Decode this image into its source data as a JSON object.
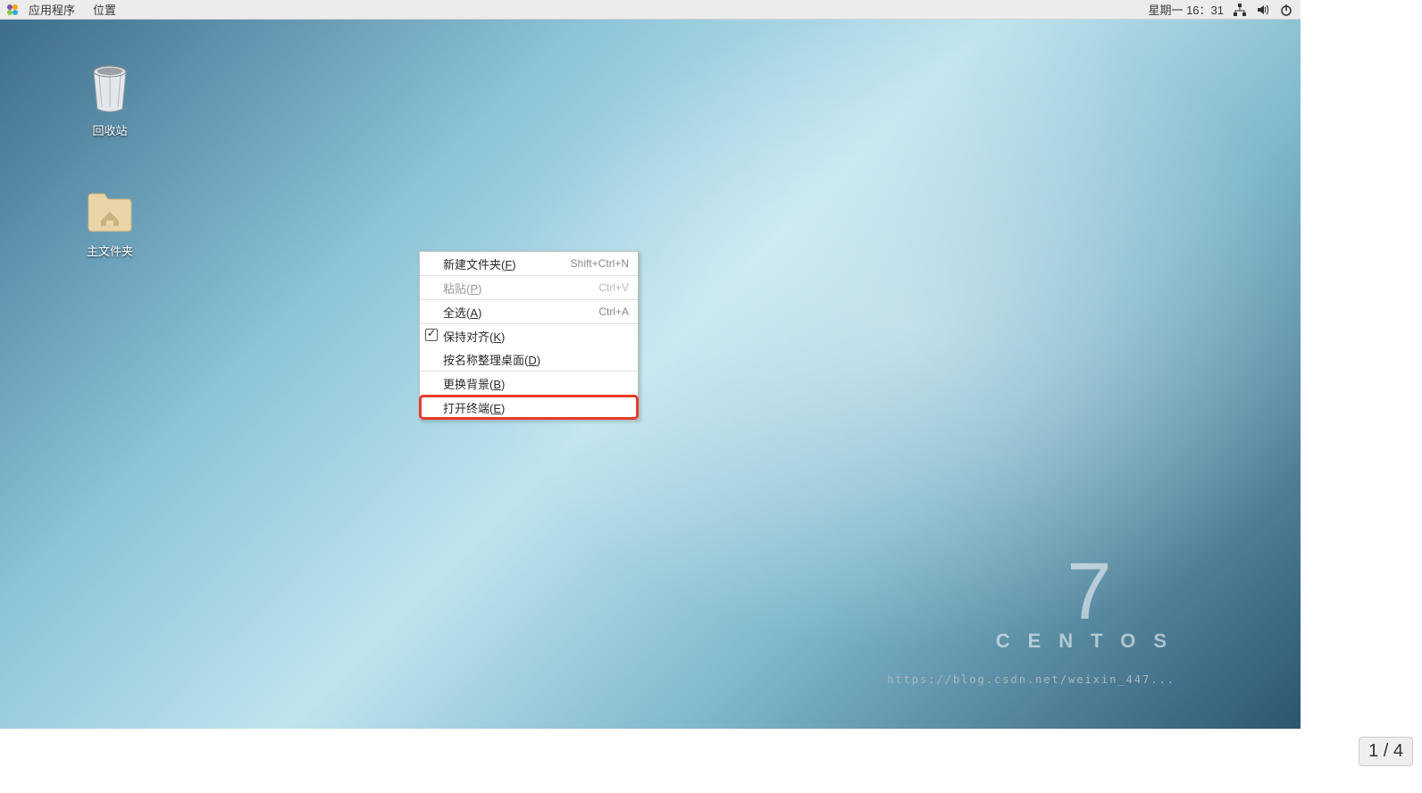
{
  "panel": {
    "menus": {
      "apps": "应用程序",
      "places": "位置"
    },
    "datetime": "星期一 16：31"
  },
  "desktop": {
    "trash": "回收站",
    "home": "主文件夹"
  },
  "context_menu": {
    "new_folder": {
      "label": "新建文件夹(",
      "accel": "F",
      "suffix": ")",
      "shortcut": "Shift+Ctrl+N"
    },
    "paste": {
      "label": "粘贴(",
      "accel": "P",
      "suffix": ")",
      "shortcut": "Ctrl+V"
    },
    "select_all": {
      "label": "全选(",
      "accel": "A",
      "suffix": ")",
      "shortcut": "Ctrl+A"
    },
    "keep_aligned": {
      "label": "保持对齐(",
      "accel": "K",
      "suffix": ")"
    },
    "sort_by_name": {
      "label": "按名称整理桌面(",
      "accel": "D",
      "suffix": ")"
    },
    "change_bg": {
      "label": "更换背景(",
      "accel": "B",
      "suffix": ")"
    },
    "open_terminal": {
      "label": "打开终端(",
      "accel": "E",
      "suffix": ")"
    }
  },
  "brand": {
    "version": "7",
    "name": "CENTOS"
  },
  "page": {
    "current": "1",
    "sep": " / ",
    "total": "4"
  },
  "watermark": "https://blog.csdn.net/weixin_447..."
}
